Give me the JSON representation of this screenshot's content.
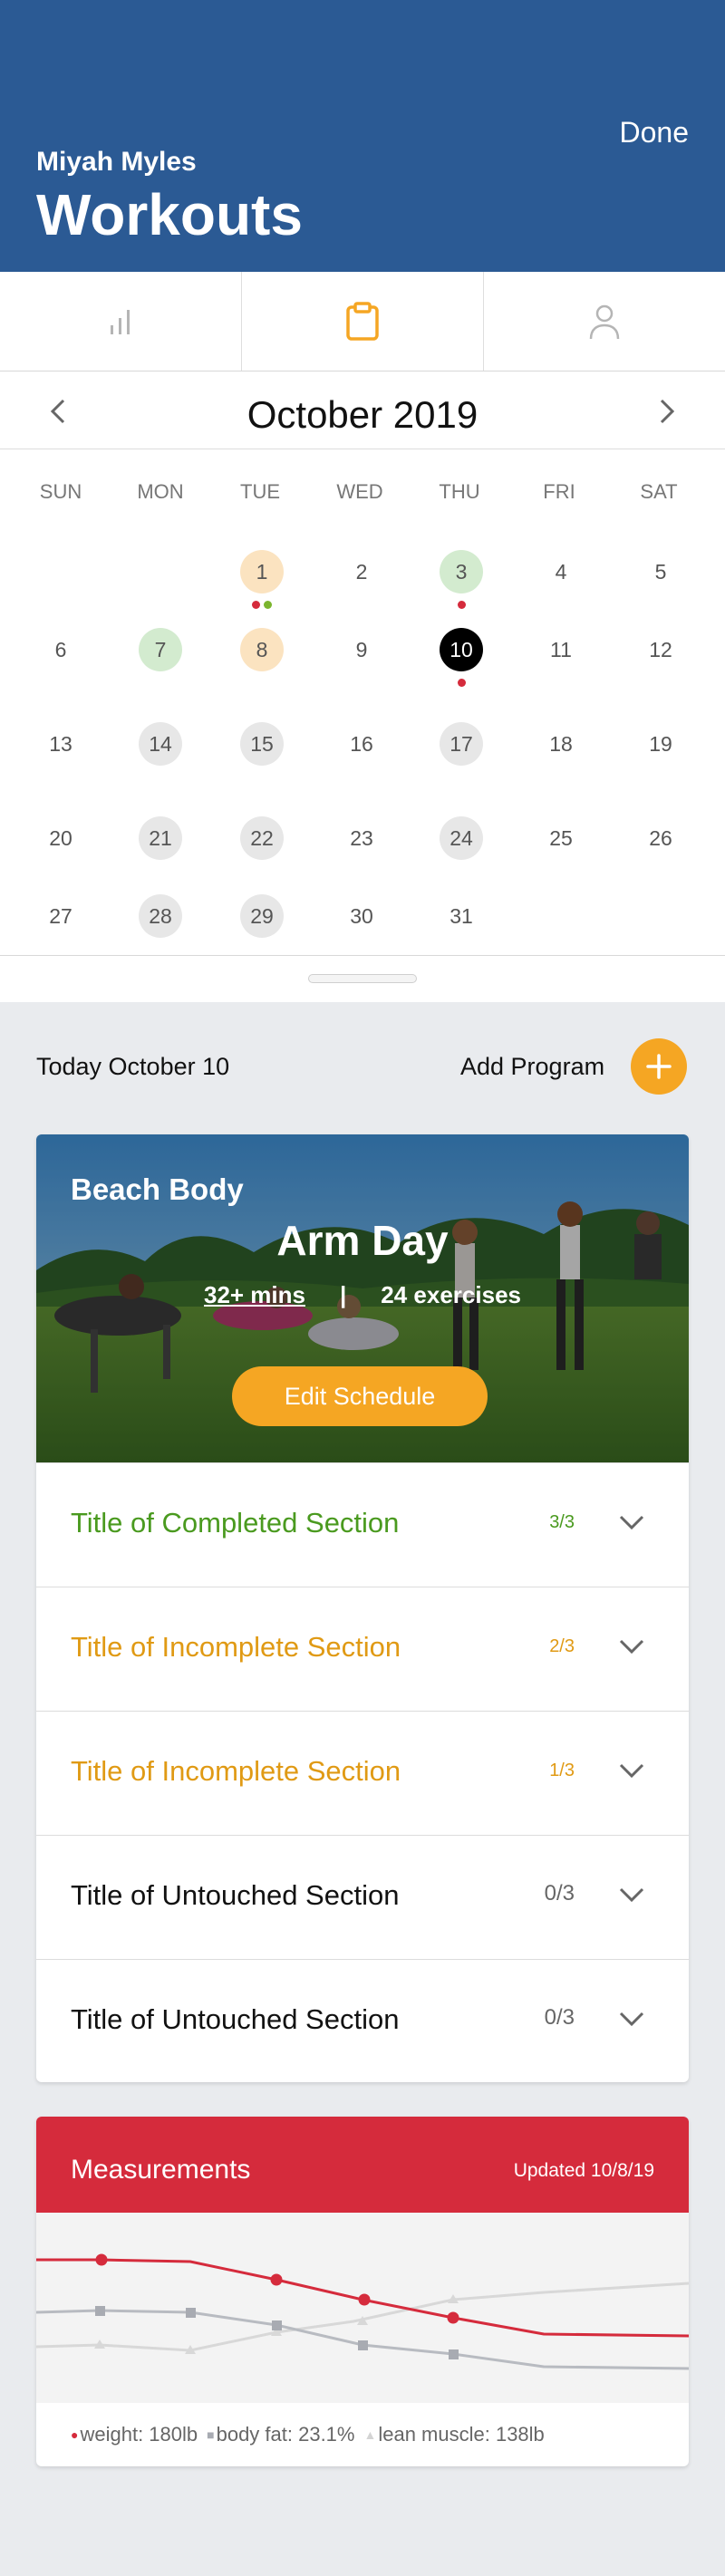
{
  "header": {
    "done_label": "Done",
    "user_name": "Miyah Myles",
    "title": "Workouts",
    "background": "#2b5a94"
  },
  "tabs": [
    {
      "icon": "bar-chart-icon",
      "active": false
    },
    {
      "icon": "clipboard-icon",
      "active": true
    },
    {
      "icon": "person-icon",
      "active": false
    }
  ],
  "calendar": {
    "month_label": "October 2019",
    "weekdays": [
      "SUN",
      "MON",
      "TUE",
      "WED",
      "THU",
      "FRI",
      "SAT"
    ],
    "first_weekday": 2,
    "days_in_month": 31,
    "today": 10,
    "status": {
      "1": "orange",
      "3": "green",
      "7": "green",
      "8": "orange",
      "10": "today",
      "14": "past",
      "15": "past",
      "17": "past",
      "21": "past",
      "22": "past",
      "24": "past",
      "28": "past",
      "29": "past"
    },
    "dots": {
      "1": [
        "#d52b3c",
        "#7bb52e"
      ],
      "3": [
        "#d52b3c"
      ],
      "10": [
        "#d52b3c"
      ]
    }
  },
  "today_label": "Today October 10",
  "add_program_label": "Add Program",
  "workout": {
    "program": "Beach Body",
    "title": "Arm Day",
    "duration": "32+ mins",
    "separator": "|",
    "exercises": "24 exercises",
    "edit_label": "Edit Schedule"
  },
  "sections": [
    {
      "title": "Title of Completed Section",
      "count": "3/3",
      "state": "complete",
      "color": "#4a9a1f"
    },
    {
      "title": "Title of Incomplete Section",
      "count": "2/3",
      "state": "incomplete",
      "color": "#e09a14"
    },
    {
      "title": "Title of Incomplete Section",
      "count": "1/3",
      "state": "incomplete",
      "color": "#e09a14"
    },
    {
      "title": "Title of Untouched Section",
      "count": "0/3",
      "state": "untouched",
      "color": "#111111"
    },
    {
      "title": "Title of Untouched Section",
      "count": "0/3",
      "state": "untouched",
      "color": "#111111"
    }
  ],
  "measurements": {
    "title": "Measurements",
    "updated": "Updated 10/8/19",
    "legend": [
      {
        "marker": "●",
        "label": "weight: 180lb",
        "color": "#d52b3c"
      },
      {
        "marker": "■",
        "label": "body fat: 23.1%",
        "color": "#a8abb2"
      },
      {
        "marker": "▲",
        "label": "lean muscle: 138lb",
        "color": "#d4d4d4"
      }
    ]
  },
  "colors": {
    "accent_orange": "#f5a623",
    "red": "#d52b3c",
    "today_bg": "#000000"
  }
}
